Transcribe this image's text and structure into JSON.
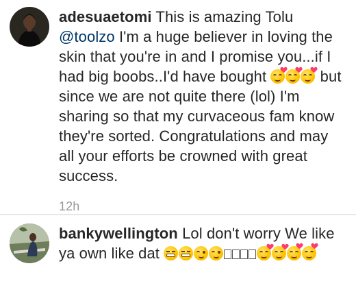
{
  "comments": [
    {
      "username": "adesuaetomi",
      "text_before_mention": "This is amazing Tolu ",
      "mention": "@toolzo",
      "text_part_1": " I'm a huge believer in loving the skin that you're in and I promise you...if I had big boobs..I'd have bought ",
      "text_part_2": " but since we are not quite there (lol) I'm sharing so that my curvaceous fam know they're sorted. Congratulations and may all your efforts be crowned with great success.",
      "time": "12h",
      "emojis_1": [
        "smiling-face-with-hearts-icon",
        "smiling-face-with-hearts-icon",
        "smiling-face-with-hearts-icon"
      ]
    },
    {
      "username": "bankywellington",
      "text": "Lol don't worry We like ya own like dat",
      "emojis": [
        "grinning-squint-icon",
        "grinning-squint-icon",
        "winking-face-icon",
        "winking-face-icon",
        "missing-glyph-box-icon",
        "missing-glyph-box-icon",
        "missing-glyph-box-icon",
        "missing-glyph-box-icon",
        "smiling-face-with-hearts-icon",
        "smiling-face-with-hearts-icon",
        "face-blowing-kiss-icon",
        "face-blowing-kiss-icon"
      ]
    }
  ],
  "colors": {
    "text": "#262626",
    "mention": "#003569",
    "timestamp": "#999999",
    "divider": "#e6e6e6"
  }
}
